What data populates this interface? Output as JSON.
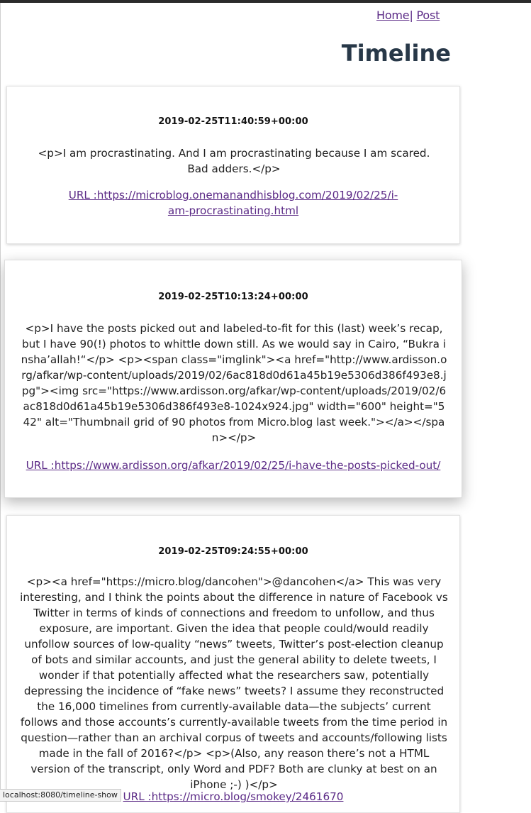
{
  "nav": {
    "home_label": "Home",
    "separator": "|",
    "post_label": "Post"
  },
  "page_title": "Timeline",
  "posts": [
    {
      "timestamp": "2019-02-25T11:40:59+00:00",
      "body": "<p>I am procrastinating. And I am procrastinating because I am scared. Bad adders.</p>",
      "url_text": "URL :https://microblog.onemanandhisblog.com/2019/02/25/i-am-procrastinating.html"
    },
    {
      "timestamp": "2019-02-25T10:13:24+00:00",
      "body": "<p>I have the posts picked out and labeled-to-fit for this (last) week’s recap, but I have 90(!) photos to whittle down still. As we would say in Cairo, “Bukra insha’allah!“</p> <p><span class=\"imglink\"><a href=\"http://www.ardisson.org/afkar/wp-content/uploads/2019/02/6ac818d0d61a45b19e5306d386f493e8.jpg\"><img src=\"https://www.ardisson.org/afkar/wp-content/uploads/2019/02/6ac818d0d61a45b19e5306d386f493e8-1024x924.jpg\" width=\"600\" height=\"542\" alt=\"Thumbnail grid of 90 photos from Micro.blog last week.\"></a></span></p>",
      "url_text": "URL :https://www.ardisson.org/afkar/2019/02/25/i-have-the-posts-picked-out/"
    },
    {
      "timestamp": "2019-02-25T09:24:55+00:00",
      "body": "<p><a href=\"https://micro.blog/dancohen\">@dancohen</a> This was very interesting, and I think the points about the difference in nature of Facebook vs Twitter in terms of kinds of connections and freedom to unfollow, and thus exposure, are important. Given the idea that people could/would readily unfollow sources of low-quality “news” tweets, Twitter’s post-election cleanup of bots and similar accounts, and just the general ability to delete tweets, I wonder if that potentially affected what the researchers saw, potentially depressing the incidence of “fake news” tweets? I assume they reconstructed the 16,000 timelines from currently-available data—the subjects’ current follows and those accounts’s currently-available tweets from the time period in question—rather than an archival corpus of tweets and accounts/following lists made in the fall of 2016?</p> <p>(Also, any reason there’s not a HTML version of the transcript, only Word and PDF? Both are clunky at best on an iPhone ;-) )</p>",
      "url_text": "URL :https://micro.blog/smokey/2461670"
    }
  ],
  "status_bar": {
    "url": "localhost:8080/timeline-show"
  },
  "colors": {
    "link": "#5b2a86",
    "title": "#283848",
    "topbar": "#2b2b2b"
  }
}
